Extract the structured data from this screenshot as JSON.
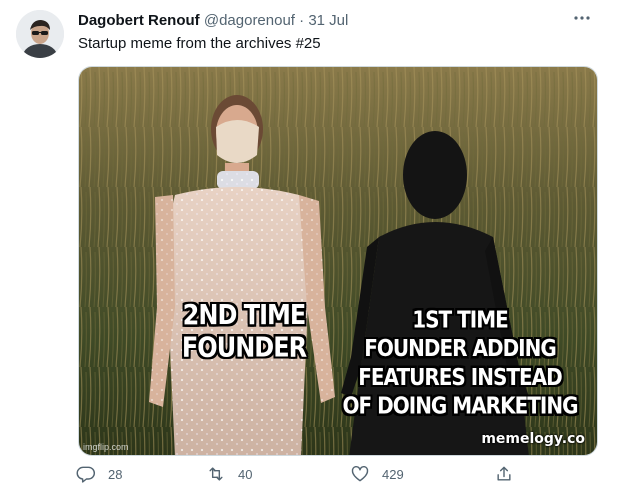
{
  "tweet": {
    "author": {
      "display_name": "Dagobert Renouf",
      "handle": "@dagorenouf",
      "separator": "·",
      "date": "31 Jul"
    },
    "text": "Startup meme from the archives #25",
    "media": {
      "caption_left": "2ND TIME\nFOUNDER",
      "caption_right": "1ST TIME\nFOUNDER ADDING\nFEATURES INSTEAD\nOF DOING MARKETING",
      "watermark_left": "imgflip.com",
      "watermark_right": "memelogy.co"
    },
    "actions": {
      "replies": "28",
      "retweets": "40",
      "likes": "429"
    }
  },
  "icons": {
    "more": "more-horizontal-icon",
    "reply": "reply-icon",
    "retweet": "retweet-icon",
    "like": "heart-icon",
    "share": "share-icon"
  },
  "colors": {
    "text_primary": "#0f1419",
    "text_secondary": "#536471",
    "border": "#cfd9de"
  }
}
